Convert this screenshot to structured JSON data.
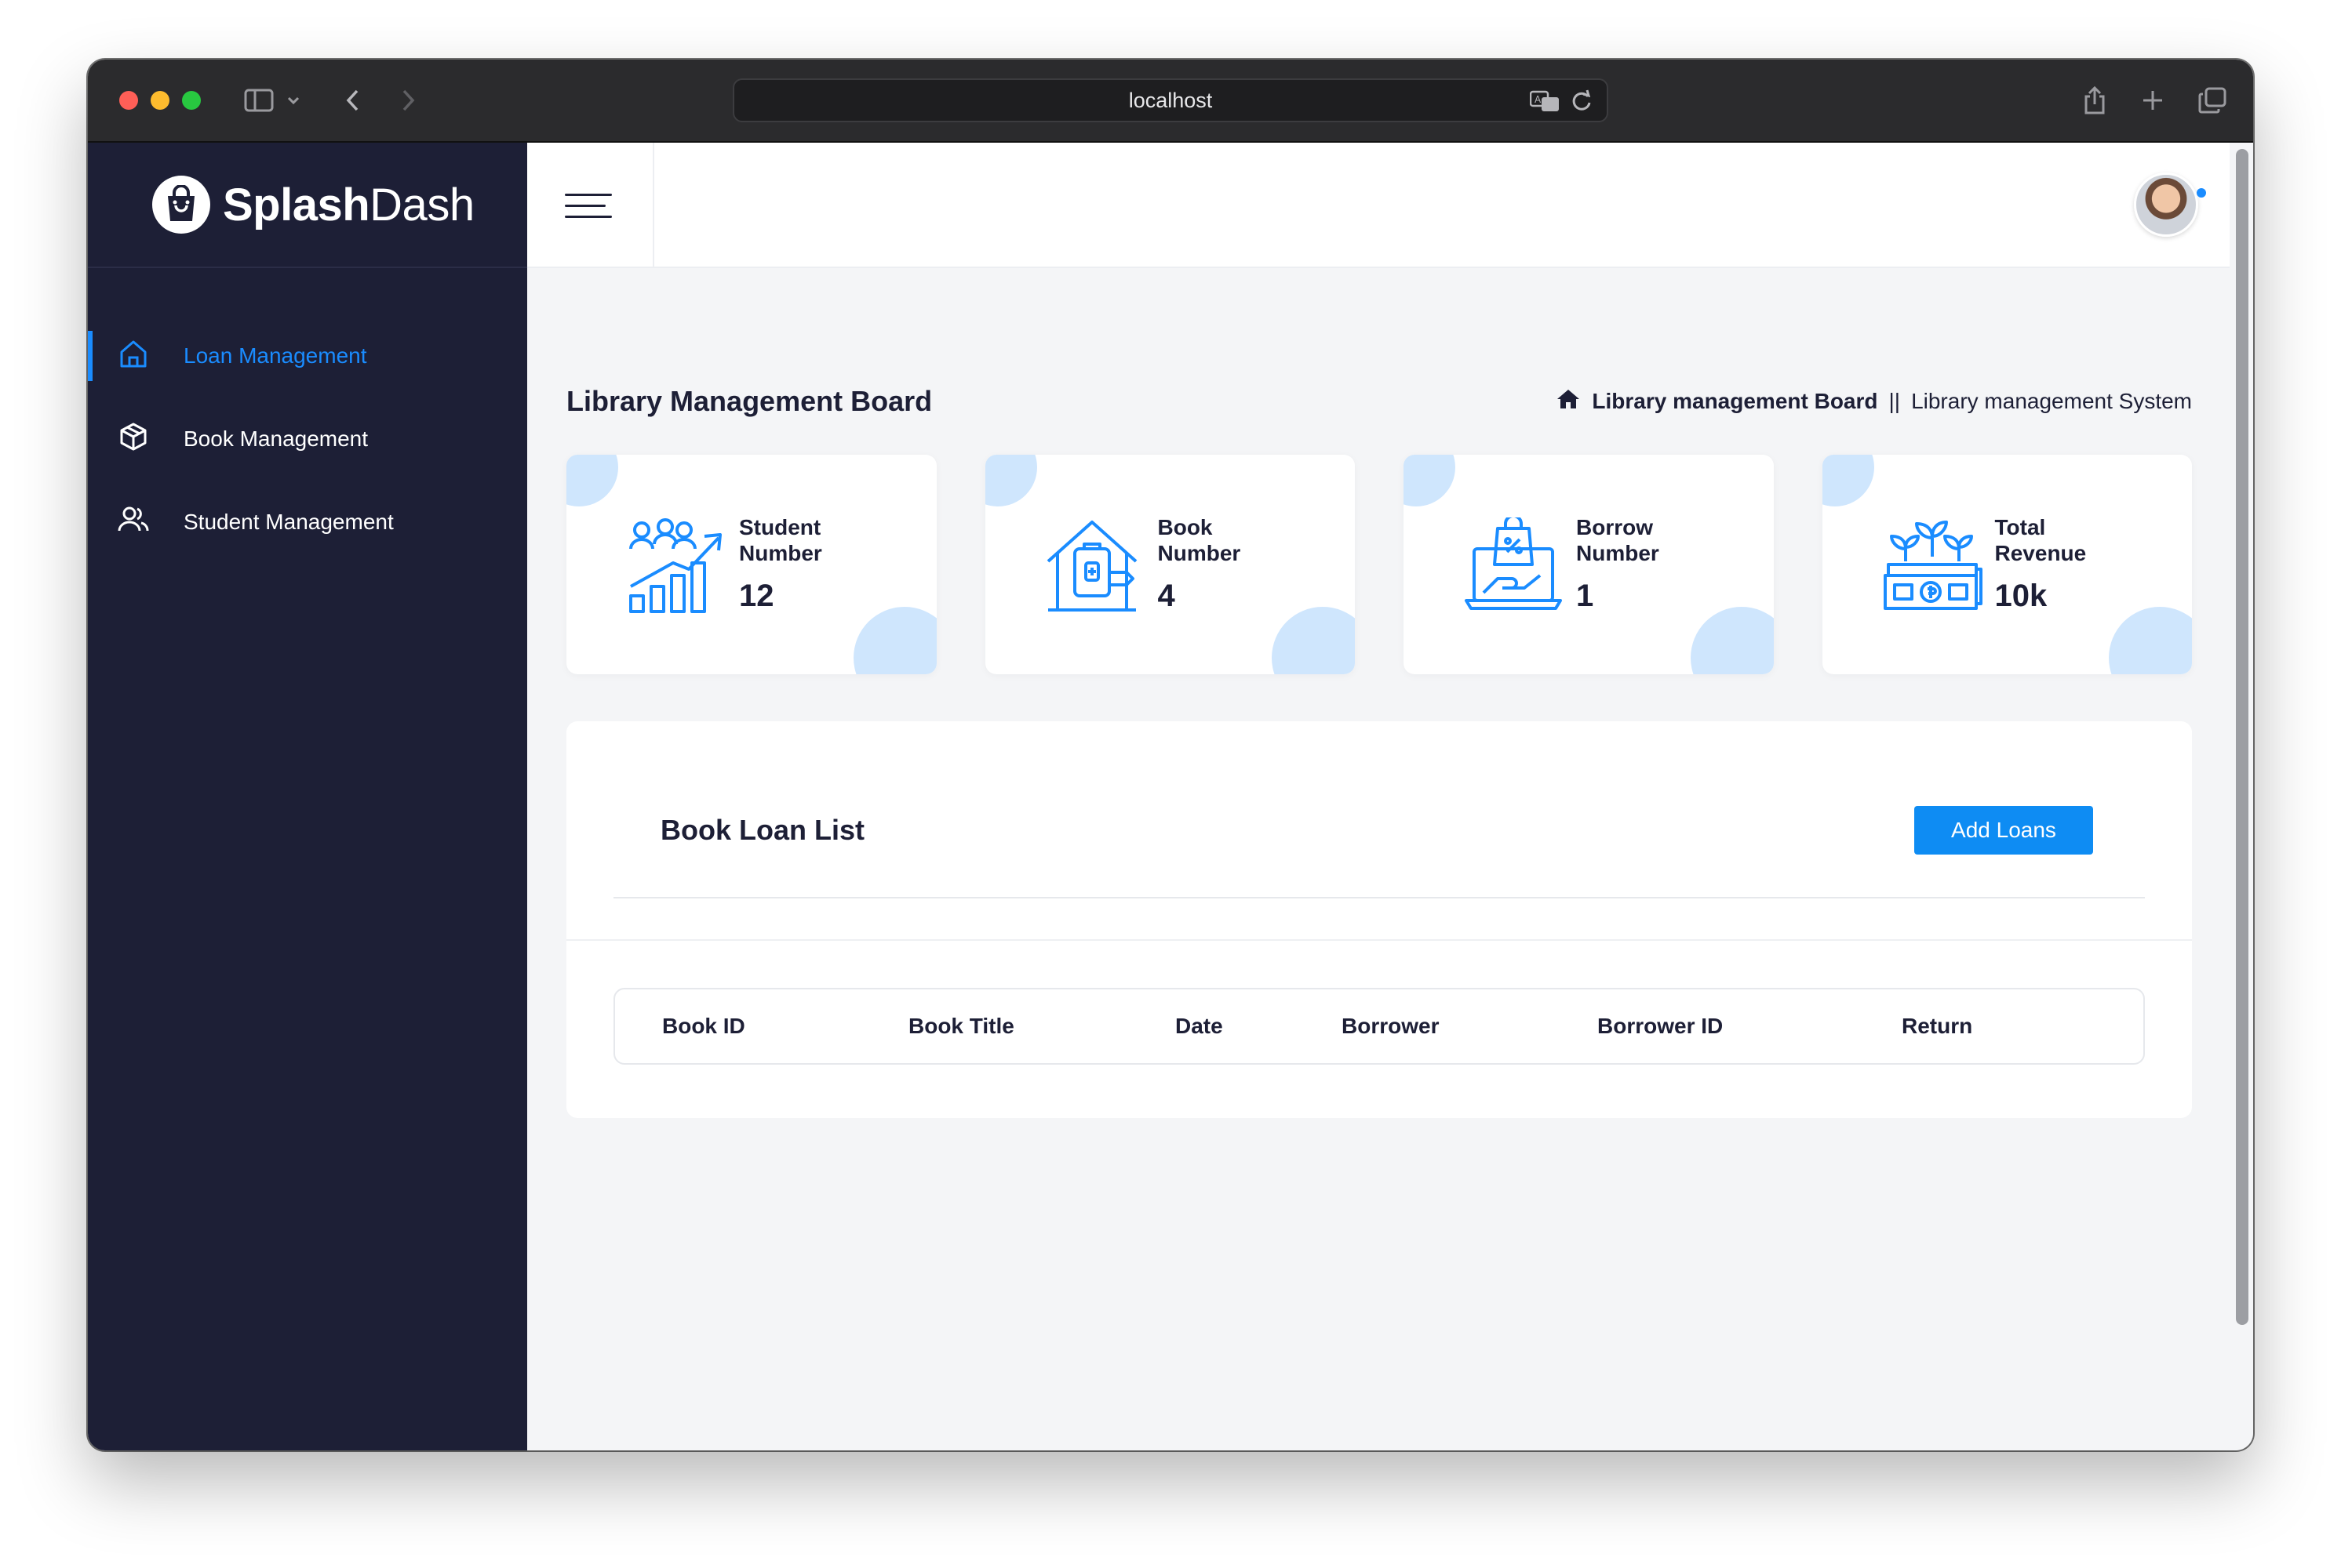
{
  "browser": {
    "url": "localhost"
  },
  "sidebar": {
    "brand": {
      "bold": "Splash",
      "light": "Dash"
    },
    "items": [
      {
        "label": "Loan Management",
        "icon": "home-icon",
        "active": true
      },
      {
        "label": "Book Management",
        "icon": "box-icon",
        "active": false
      },
      {
        "label": "Student Management",
        "icon": "users-icon",
        "active": false
      }
    ]
  },
  "header": {
    "page_title": "Library Management Board",
    "breadcrumb": {
      "current": "Library management Board",
      "separator": "||",
      "parent": "Library management System"
    }
  },
  "stats": [
    {
      "label_line1": "Student",
      "label_line2": "Number",
      "value": "12",
      "icon": "student-growth-icon"
    },
    {
      "label_line1": "Book",
      "label_line2": "Number",
      "value": "4",
      "icon": "book-house-icon"
    },
    {
      "label_line1": "Borrow",
      "label_line2": "Number",
      "value": "1",
      "icon": "borrow-laptop-icon"
    },
    {
      "label_line1": "Total",
      "label_line2": "Revenue",
      "value": "10k",
      "icon": "revenue-plant-icon"
    }
  ],
  "loans": {
    "title": "Book Loan List",
    "add_button": "Add Loans",
    "columns": [
      "Book ID",
      "Book Title",
      "Date",
      "Borrower",
      "Borrower ID",
      "Return"
    ],
    "rows": []
  },
  "colors": {
    "accent": "#1a8cff",
    "sidebar_bg": "#1d1f36",
    "card_blob": "#cfe6fd"
  }
}
